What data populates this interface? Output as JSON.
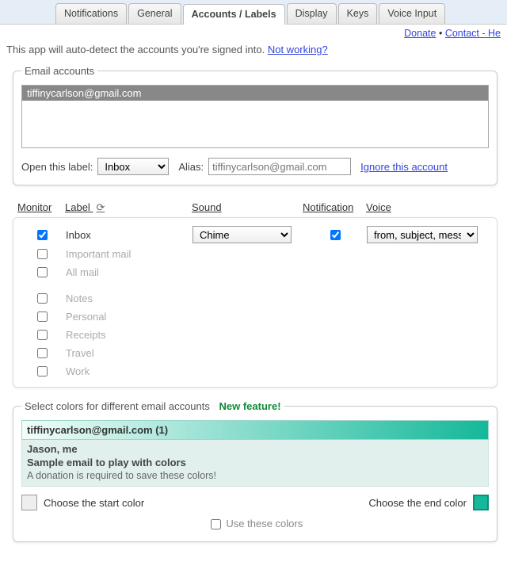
{
  "tabs": [
    "Notifications",
    "General",
    "Accounts / Labels",
    "Display",
    "Keys",
    "Voice Input"
  ],
  "active_tab": "Accounts / Labels",
  "top_links": {
    "donate": "Donate",
    "sep": "•",
    "contact": "Contact - He"
  },
  "desc": {
    "text": "This app will auto-detect the accounts you're signed into. ",
    "link": "Not working?"
  },
  "accounts_panel": {
    "legend": "Email accounts",
    "selected_account": "tiffinycarlson@gmail.com",
    "open_label_text": "Open this label:",
    "open_label_value": "Inbox",
    "alias_text": "Alias:",
    "alias_placeholder": "tiffinycarlson@gmail.com",
    "ignore_link": "Ignore this account"
  },
  "labels_columns": {
    "monitor": "Monitor",
    "label": "Label",
    "sound": "Sound",
    "notification": "Notification",
    "voice": "Voice"
  },
  "refresh_glyph": "⟳",
  "labels": [
    {
      "name": "Inbox",
      "monitor": true,
      "sound": "Chime",
      "notification": true,
      "voice": "from, subject, mess",
      "enabled": true
    },
    {
      "name": "Important mail",
      "monitor": false,
      "enabled": false
    },
    {
      "name": "All mail",
      "monitor": false,
      "enabled": false
    },
    {
      "name": "Notes",
      "monitor": false,
      "enabled": false
    },
    {
      "name": "Personal",
      "monitor": false,
      "enabled": false
    },
    {
      "name": "Receipts",
      "monitor": false,
      "enabled": false
    },
    {
      "name": "Travel",
      "monitor": false,
      "enabled": false
    },
    {
      "name": "Work",
      "monitor": false,
      "enabled": false
    }
  ],
  "colors_panel": {
    "legend": "Select colors for different email accounts",
    "new_feature": "New feature!",
    "header": "tiffinycarlson@gmail.com (1)",
    "from": "Jason, me",
    "subject": "Sample email to play with colors",
    "donation_note": "A donation is required to save these colors!",
    "start_label": "Choose the start color",
    "end_label": "Choose the end color",
    "use_colors": "Use these colors",
    "start_color": "#f3fdfa",
    "end_color": "#14b89a"
  }
}
